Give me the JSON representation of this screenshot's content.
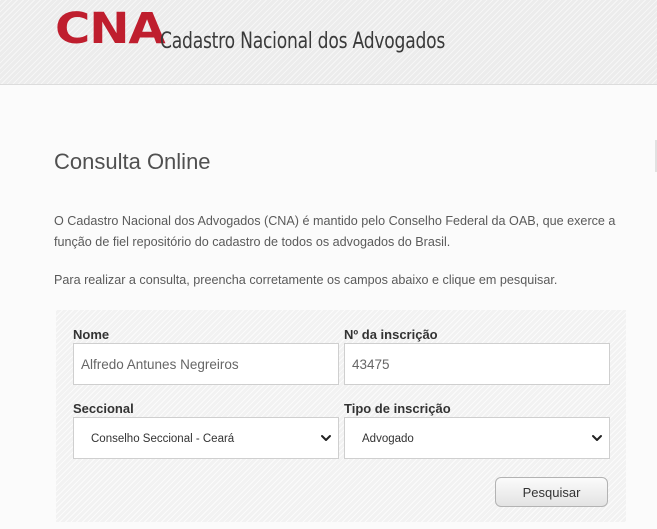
{
  "header": {
    "logo": "CNA",
    "site_name": "Cadastro Nacional dos Advogados"
  },
  "main": {
    "title": "Consulta Online",
    "intro": "O Cadastro Nacional dos Advogados (CNA) é mantido pelo Conselho Federal da OAB, que exerce a função de fiel repositório do cadastro de todos os advogados do Brasil.",
    "instructions": "Para realizar a consulta, preencha corretamente os campos abaixo e clique em pesquisar."
  },
  "form": {
    "nome_label": "Nome",
    "nome_value": "Alfredo Antunes Negreiros",
    "inscricao_label": "Nº da inscrição",
    "inscricao_value": "43475",
    "seccional_label": "Seccional",
    "seccional_value": "Conselho Seccional - Ceará",
    "tipo_label": "Tipo de inscrição",
    "tipo_value": "Advogado",
    "search_button": "Pesquisar"
  },
  "colors": {
    "brand": "#bf1e2e",
    "header_background": "#ececec",
    "panel_background": "#f2f2f2"
  },
  "icons": {
    "select_arrow": "chevron-down-icon"
  }
}
